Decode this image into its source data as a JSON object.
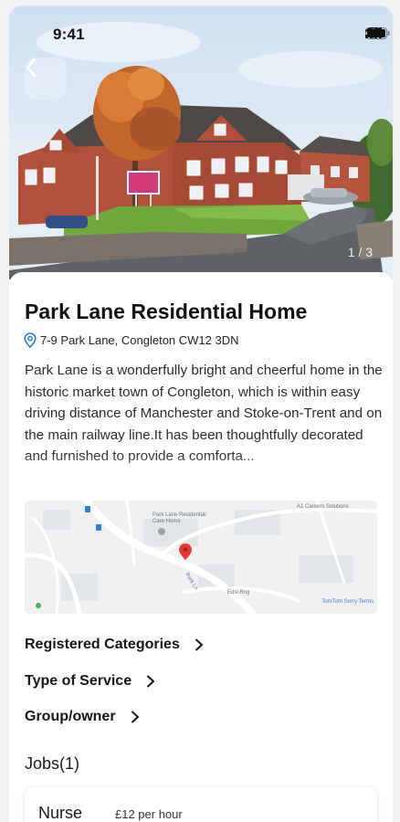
{
  "status_bar": {
    "time": "9:41"
  },
  "hero": {
    "photo_counter": "1 / 3",
    "sign_text": "Park Lane"
  },
  "home": {
    "name": "Park Lane Residential Home",
    "address": "7-9 Park Lane, Congleton CW12 3DN",
    "description": "Park Lane is a wonderfully bright and cheerful home in the historic market town of Congleton, which is within easy driving distance of Manchester and Stoke-on-Trent and on the main railway line.It has been thoughtfully decorated and furnished to provide a comforta..."
  },
  "map": {
    "place_label": "Park Lane Residential Care Home",
    "road_labels": [
      "Park Ln",
      "Edsl Rng"
    ],
    "corner_label": "A1 Careers Solutions",
    "attribution": "TomTom Sorry Terms"
  },
  "links": [
    {
      "label": "Registered Categories"
    },
    {
      "label": "Type of Service"
    },
    {
      "label": "Group/owner"
    }
  ],
  "jobs": {
    "title": "Jobs(1)",
    "items": [
      {
        "title": "Nurse",
        "pay": "£12 per hour"
      }
    ]
  },
  "colors": {
    "accent": "#2a7fd4",
    "pin": "#e53935"
  }
}
